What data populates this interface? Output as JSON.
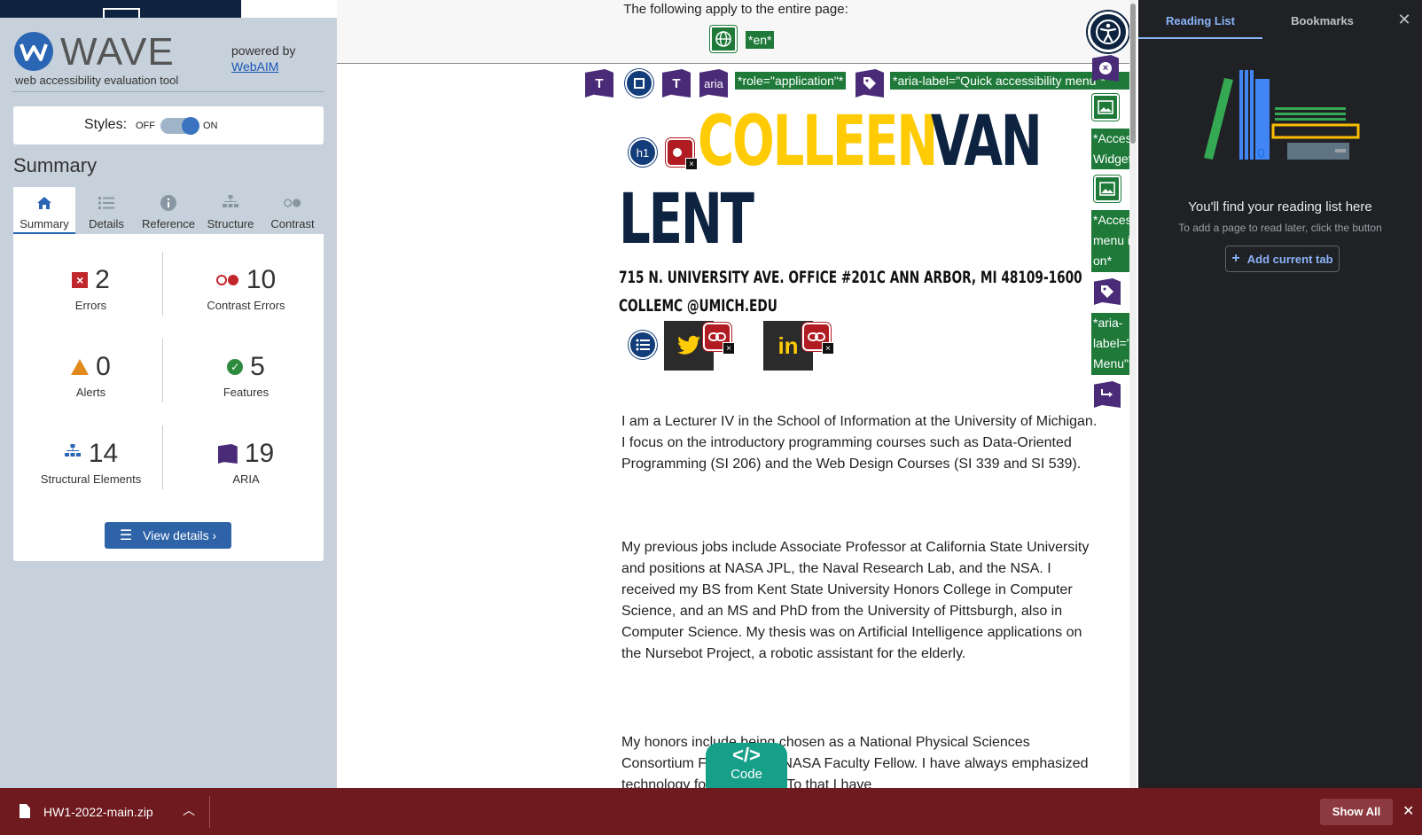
{
  "wave": {
    "logo_letter": "W",
    "title": "WAVE",
    "tagline": "web accessibility evaluation tool",
    "powered_by": "powered by",
    "webaim_link": "WebAIM",
    "styles_label": "Styles:",
    "styles_off": "OFF",
    "styles_on": "ON",
    "summary_heading": "Summary",
    "tabs": [
      {
        "label": "Summary",
        "icon": "home-icon",
        "active": true
      },
      {
        "label": "Details",
        "icon": "list-icon"
      },
      {
        "label": "Reference",
        "icon": "info-icon"
      },
      {
        "label": "Structure",
        "icon": "structure-icon"
      },
      {
        "label": "Contrast",
        "icon": "contrast-icon"
      }
    ],
    "stats": {
      "errors": {
        "count": "2",
        "label": "Errors"
      },
      "contrast_errors": {
        "count": "10",
        "label": "Contrast Errors"
      },
      "alerts": {
        "count": "0",
        "label": "Alerts"
      },
      "features": {
        "count": "5",
        "label": "Features"
      },
      "structural": {
        "count": "14",
        "label": "Structural Elements"
      },
      "aria": {
        "count": "19",
        "label": "ARIA"
      }
    },
    "view_details": "View details ›"
  },
  "page": {
    "banner_text": "The following apply to the entire page:",
    "lang_label": "*en*",
    "aria_text": "aria",
    "role_label": "*role=\"application\"*",
    "aria_label_1": "*aria-label=\"Quick accessibility menu\"*",
    "side_label_1": "*Accessibility Widget*",
    "side_label_2": "*Accessibility menu is on*",
    "side_label_3": "*aria-label=\"Accessibility Menu\"*",
    "h1_badge": "h1",
    "name_first": "COLLEEN",
    "name_last_1": "VAN",
    "name_last_2": "LENT",
    "address": "715 N. UNIVERSITY AVE. OFFICE #201C ANN ARBOR, MI 48109-1600",
    "email": "COLLEMC @UMICH.EDU",
    "paragraphs": [
      "I am a Lecturer IV in the School of Information at the University of Michigan. I focus on the introductory programming courses such as Data-Oriented Programming (SI 206) and the Web Design Courses (SI 339 and SI 539).",
      "My previous jobs include Associate Professor at California State University and positions at NASA JPL, the Naval Research Lab, and the NSA. I received my BS from Kent State University Honors College in Computer Science, and an MS and PhD from the University of Pittsburgh, also in Computer Science. My thesis was on Artificial Intelligence applications on the Nursebot Project, a robotic assistant for the elderly.",
      "My honors include being chosen as a National Physical Sciences Consortium Fellow and a NASA Faculty Fellow. I have always emphasized technology for everybody. To that I have"
    ],
    "code_icon": "</>",
    "code_label": "Code"
  },
  "reading_panel": {
    "tab_reading": "Reading List",
    "tab_bookmarks": "Bookmarks",
    "empty_title": "You'll find your reading list here",
    "empty_sub": "To add a page to read later, click the button",
    "add_button": "Add current tab"
  },
  "download_bar": {
    "file_name": "HW1-2022-main.zip",
    "show_all": "Show All"
  },
  "colors": {
    "wave_blue": "#2a66b3",
    "umich_maize": "#ffcb05",
    "umich_blue": "#0d2340",
    "wave_green": "#1f7a3a",
    "wave_purple": "#4a2b78",
    "download_bar": "#6e1a1f"
  }
}
